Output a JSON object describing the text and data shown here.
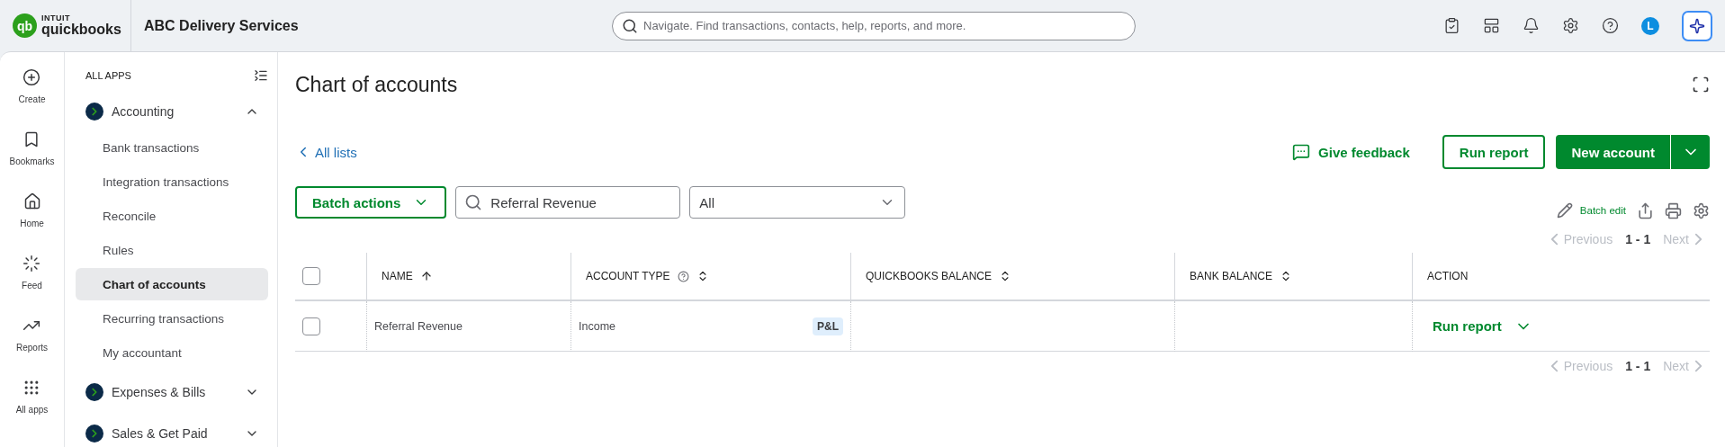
{
  "top_bar": {
    "logo": {
      "mark": "qb",
      "maker": "INTUIT",
      "product": "quickbooks"
    },
    "company": "ABC Delivery Services",
    "search": {
      "placeholder": "Navigate. Find transactions, contacts, help, reports, and more."
    },
    "icons": [
      {
        "kind": "tasks"
      },
      {
        "kind": "apps"
      },
      {
        "kind": "notifications"
      },
      {
        "kind": "settings"
      },
      {
        "kind": "help"
      }
    ],
    "avatar": "L"
  },
  "nav_rail": [
    {
      "kind": "create",
      "label": "Create"
    },
    {
      "kind": "bookmarks",
      "label": "Bookmarks"
    },
    {
      "kind": "home",
      "label": "Home"
    },
    {
      "kind": "feed",
      "label": "Feed"
    },
    {
      "kind": "reports",
      "label": "Reports"
    },
    {
      "kind": "all_apps",
      "label": "All apps"
    }
  ],
  "sidebar": {
    "heading": "ALL APPS",
    "groups": [
      {
        "label": "Accounting",
        "expanded": true,
        "children": [
          {
            "label": "Bank transactions",
            "selected": false
          },
          {
            "label": "Integration transactions",
            "selected": false
          },
          {
            "label": "Reconcile",
            "selected": false
          },
          {
            "label": "Rules",
            "selected": false
          },
          {
            "label": "Chart of accounts",
            "selected": true
          },
          {
            "label": "Recurring transactions",
            "selected": false
          },
          {
            "label": "My accountant",
            "selected": false
          }
        ]
      },
      {
        "label": "Expenses & Bills",
        "expanded": false
      },
      {
        "label": "Sales & Get Paid",
        "expanded": false
      }
    ]
  },
  "page": {
    "title": "Chart of accounts",
    "back_link": "All lists",
    "feedback": "Give feedback",
    "run_report": "Run report",
    "new_account": "New account",
    "batch_actions": "Batch actions",
    "search": {
      "value": "Referral Revenue"
    },
    "filter": {
      "value": "All"
    },
    "batch_edit": "Batch edit",
    "pagination_top": {
      "previous": "Previous",
      "range": "1 - 1",
      "next": "Next",
      "previous_disabled": true,
      "next_disabled": true
    },
    "table": {
      "select_all": {
        "checked": false
      },
      "columns": [
        {
          "label": "NAME",
          "sortable": true,
          "sorted_ascending": true,
          "help": false
        },
        {
          "label": "ACCOUNT TYPE",
          "sortable": true,
          "sorted_ascending": false,
          "help": true
        },
        {
          "label": "QUICKBOOKS BALANCE",
          "sortable": true,
          "sorted_ascending": false,
          "help": false
        },
        {
          "label": "BANK BALANCE",
          "sortable": true,
          "sorted_ascending": false,
          "help": false
        },
        {
          "label": "ACTION",
          "sortable": false,
          "help": false
        }
      ],
      "rows": [
        {
          "checked": false,
          "name": "Referral Revenue",
          "account_type": "Income",
          "tag": "P&L",
          "action": "Run report"
        }
      ]
    },
    "pagination_bottom": {
      "previous": "Previous",
      "range": "1 - 1",
      "next": "Next",
      "previous_disabled": true,
      "next_disabled": true
    }
  }
}
